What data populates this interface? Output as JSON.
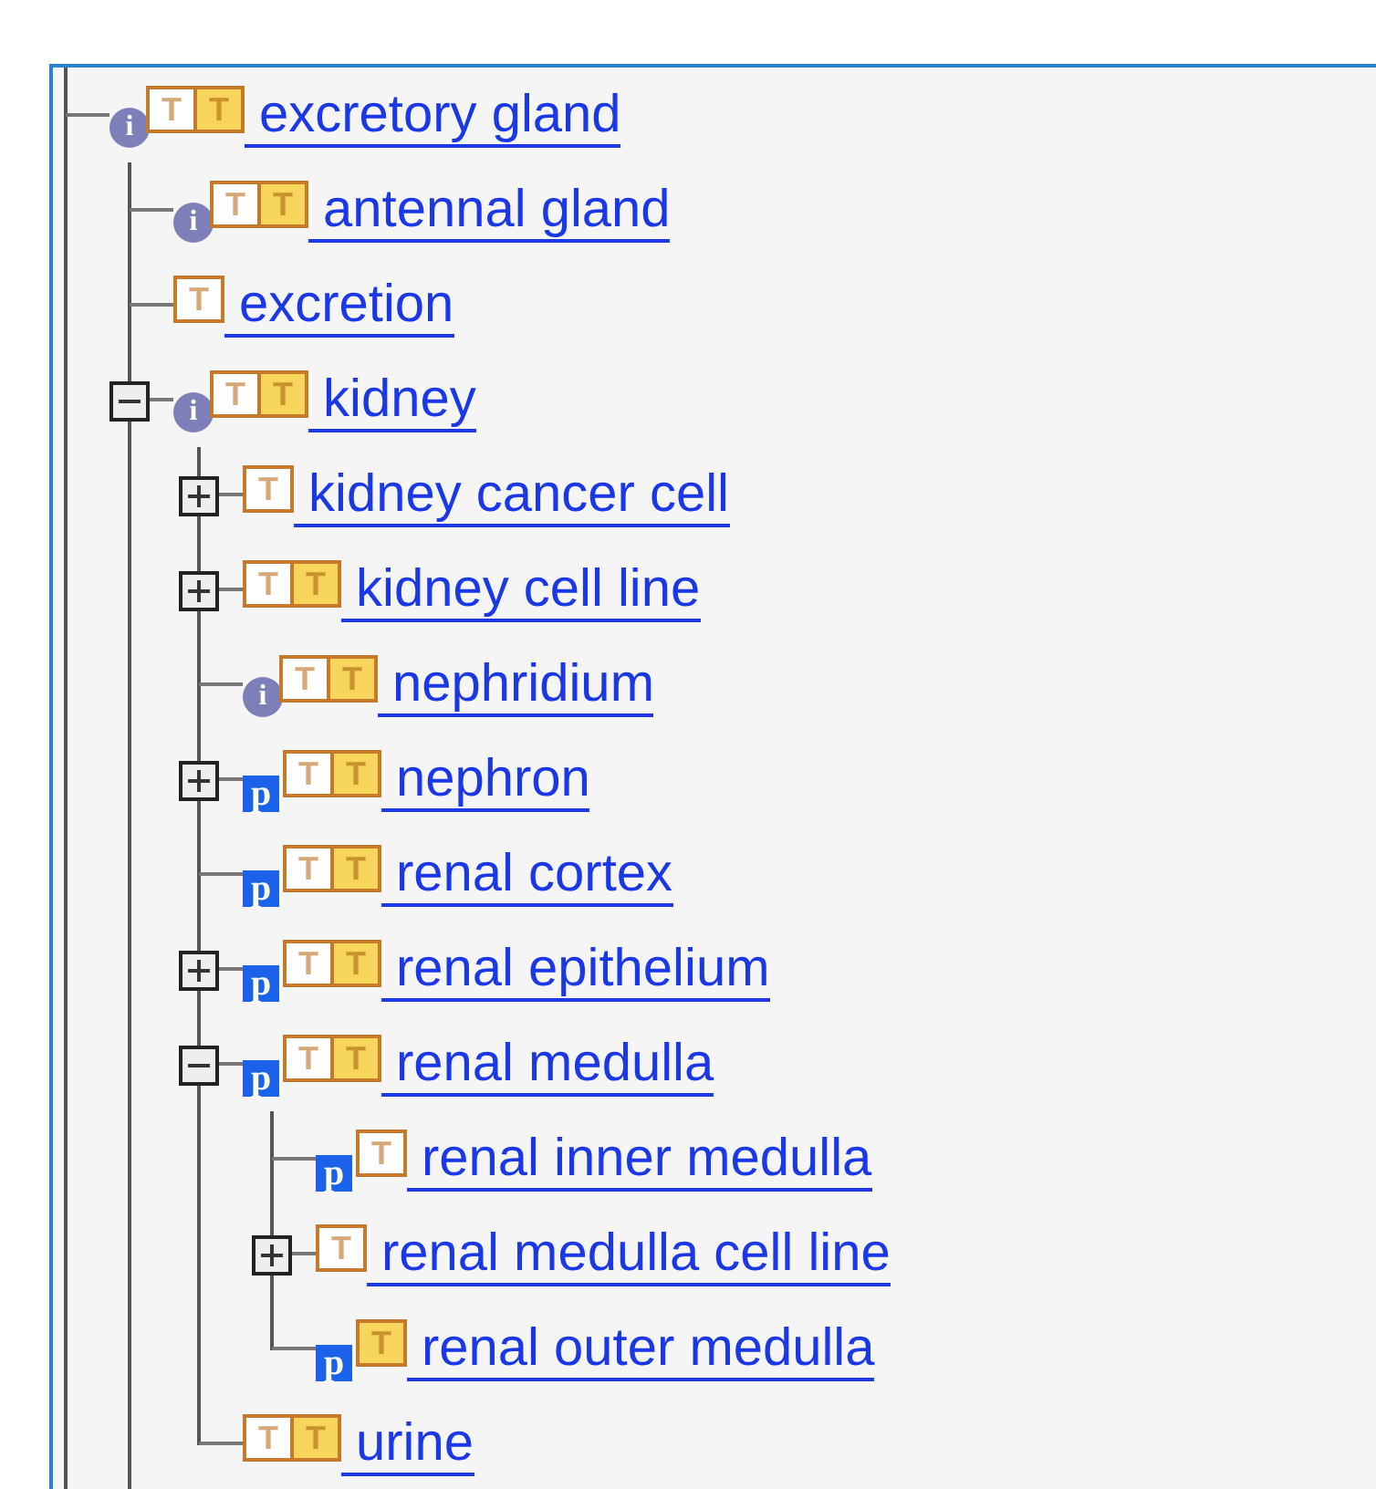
{
  "more_below": true,
  "tree": [
    {
      "label": "excretory gland",
      "badges": [
        {
          "kind": "info",
          "glyph": "i"
        },
        {
          "kind": "term",
          "glyph": "T"
        },
        {
          "kind": "term-marked",
          "glyph": "T"
        }
      ],
      "more_below": true,
      "children": [
        {
          "label": "antennal gland",
          "badges": [
            {
              "kind": "info",
              "glyph": "i"
            },
            {
              "kind": "term",
              "glyph": "T"
            },
            {
              "kind": "term-marked",
              "glyph": "T"
            }
          ]
        },
        {
          "label": "excretion",
          "badges": [
            {
              "kind": "term",
              "glyph": "T"
            }
          ]
        },
        {
          "label": "kidney",
          "expanded": true,
          "badges": [
            {
              "kind": "info",
              "glyph": "i"
            },
            {
              "kind": "term",
              "glyph": "T"
            },
            {
              "kind": "term-marked",
              "glyph": "T"
            }
          ],
          "children": [
            {
              "label": "kidney cancer cell",
              "expanded": false,
              "badges": [
                {
                  "kind": "term",
                  "glyph": "T"
                }
              ]
            },
            {
              "label": "kidney cell line",
              "expanded": false,
              "badges": [
                {
                  "kind": "term",
                  "glyph": "T"
                },
                {
                  "kind": "term-marked",
                  "glyph": "T"
                }
              ]
            },
            {
              "label": "nephridium",
              "badges": [
                {
                  "kind": "info",
                  "glyph": "i"
                },
                {
                  "kind": "term",
                  "glyph": "T"
                },
                {
                  "kind": "term-marked",
                  "glyph": "T"
                }
              ]
            },
            {
              "label": "nephron",
              "expanded": false,
              "badges": [
                {
                  "kind": "protein",
                  "glyph": "p"
                },
                {
                  "kind": "term",
                  "glyph": "T"
                },
                {
                  "kind": "term-marked",
                  "glyph": "T"
                }
              ]
            },
            {
              "label": "renal cortex",
              "badges": [
                {
                  "kind": "protein",
                  "glyph": "p"
                },
                {
                  "kind": "term",
                  "glyph": "T"
                },
                {
                  "kind": "term-marked",
                  "glyph": "T"
                }
              ]
            },
            {
              "label": "renal epithelium",
              "expanded": false,
              "badges": [
                {
                  "kind": "protein",
                  "glyph": "p"
                },
                {
                  "kind": "term",
                  "glyph": "T"
                },
                {
                  "kind": "term-marked",
                  "glyph": "T"
                }
              ]
            },
            {
              "label": "renal medulla",
              "expanded": true,
              "badges": [
                {
                  "kind": "protein",
                  "glyph": "p"
                },
                {
                  "kind": "term",
                  "glyph": "T"
                },
                {
                  "kind": "term-marked",
                  "glyph": "T"
                }
              ],
              "children": [
                {
                  "label": "renal inner medulla",
                  "badges": [
                    {
                      "kind": "protein",
                      "glyph": "p"
                    },
                    {
                      "kind": "term",
                      "glyph": "T"
                    }
                  ]
                },
                {
                  "label": "renal medulla cell line",
                  "expanded": false,
                  "badges": [
                    {
                      "kind": "term",
                      "glyph": "T"
                    }
                  ]
                },
                {
                  "label": "renal outer medulla",
                  "badges": [
                    {
                      "kind": "protein",
                      "glyph": "p"
                    },
                    {
                      "kind": "term-marked",
                      "glyph": "T"
                    }
                  ]
                }
              ]
            },
            {
              "label": "urine",
              "badges": [
                {
                  "kind": "term",
                  "glyph": "T"
                },
                {
                  "kind": "term-marked",
                  "glyph": "T"
                }
              ]
            }
          ]
        }
      ]
    }
  ]
}
